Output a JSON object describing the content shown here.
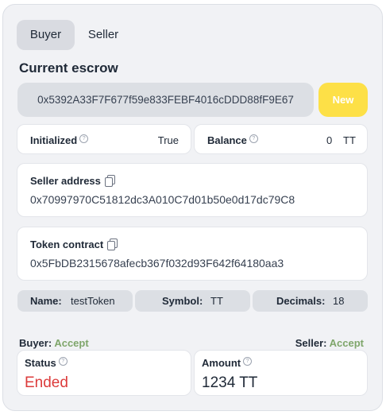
{
  "tabs": [
    {
      "label": "Buyer",
      "active": true
    },
    {
      "label": "Seller",
      "active": false
    }
  ],
  "escrow": {
    "title": "Current escrow",
    "address": "0x5392A33F7F677f59e833FEBF4016cDDD88fF9E67",
    "new_label": "New"
  },
  "initialized": {
    "label": "Initialized",
    "value": "True"
  },
  "balance": {
    "label": "Balance",
    "amount": "0",
    "unit": "TT"
  },
  "seller_address": {
    "label": "Seller address",
    "value": "0x70997970C51812dc3A010C7d01b50e0d17dc79C8"
  },
  "token_contract": {
    "label": "Token contract",
    "value": "0x5FbDB2315678afecb367f032d93F642f64180aa3"
  },
  "token": {
    "name_label": "Name:",
    "name_value": "testToken",
    "symbol_label": "Symbol:",
    "symbol_value": "TT",
    "decimals_label": "Decimals:",
    "decimals_value": "18"
  },
  "parties": {
    "buyer_label": "Buyer:",
    "buyer_status": "Accept",
    "seller_label": "Seller:",
    "seller_status": "Accept"
  },
  "status": {
    "label": "Status",
    "value": "Ended"
  },
  "amount": {
    "label": "Amount",
    "value": "1234 TT"
  },
  "colors": {
    "accent_yellow": "#fde047",
    "accept_green": "#7fa66b",
    "ended_red": "#dc3b3b"
  },
  "icons": [
    "info-icon",
    "copy-icon"
  ]
}
